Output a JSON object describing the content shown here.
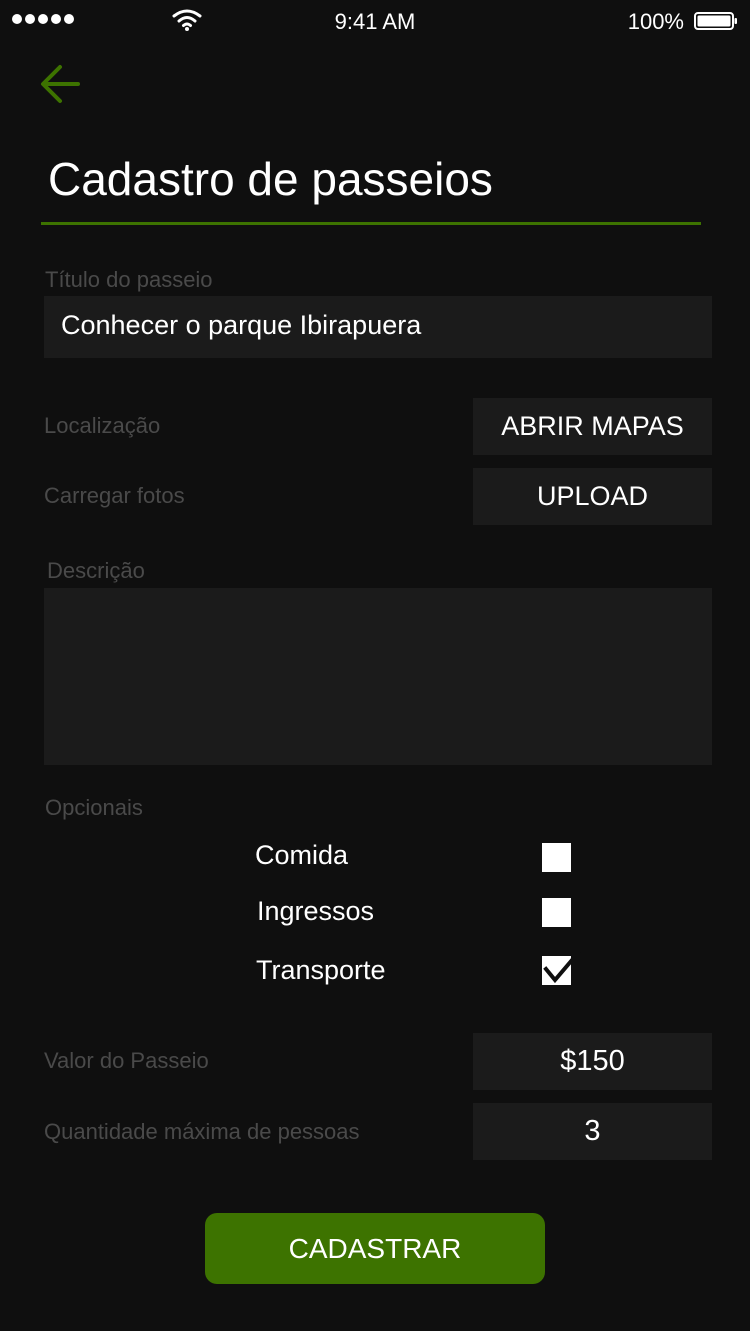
{
  "status_bar": {
    "time": "9:41 AM",
    "battery": "100%",
    "icons": [
      "signal-dots-icon",
      "wifi-icon",
      "battery-icon"
    ]
  },
  "header": {
    "back_icon": "arrow-left-icon",
    "title": "Cadastro de passeios"
  },
  "form": {
    "titulo": {
      "label": "Título do passeio",
      "value": "Conhecer o parque Ibirapuera"
    },
    "localizacao": {
      "label": "Localização",
      "button": "ABRIR MAPAS"
    },
    "fotos": {
      "label": "Carregar fotos",
      "button": "UPLOAD"
    },
    "descricao": {
      "label": "Descrição",
      "value": ""
    },
    "opcionais": {
      "label": "Opcionais",
      "items": [
        {
          "label": "Comida",
          "checked": false
        },
        {
          "label": "Ingressos",
          "checked": false
        },
        {
          "label": "Transporte",
          "checked": true
        }
      ]
    },
    "valor": {
      "label": "Valor do Passeio",
      "value": "$150"
    },
    "quantidade": {
      "label": "Quantidade máxima de pessoas",
      "value": "3"
    },
    "submit": "CADASTRAR"
  },
  "colors": {
    "background": "#0f0f0f",
    "field": "#1b1b1b",
    "accent": "#3d7300",
    "label": "#4a4a4a"
  }
}
